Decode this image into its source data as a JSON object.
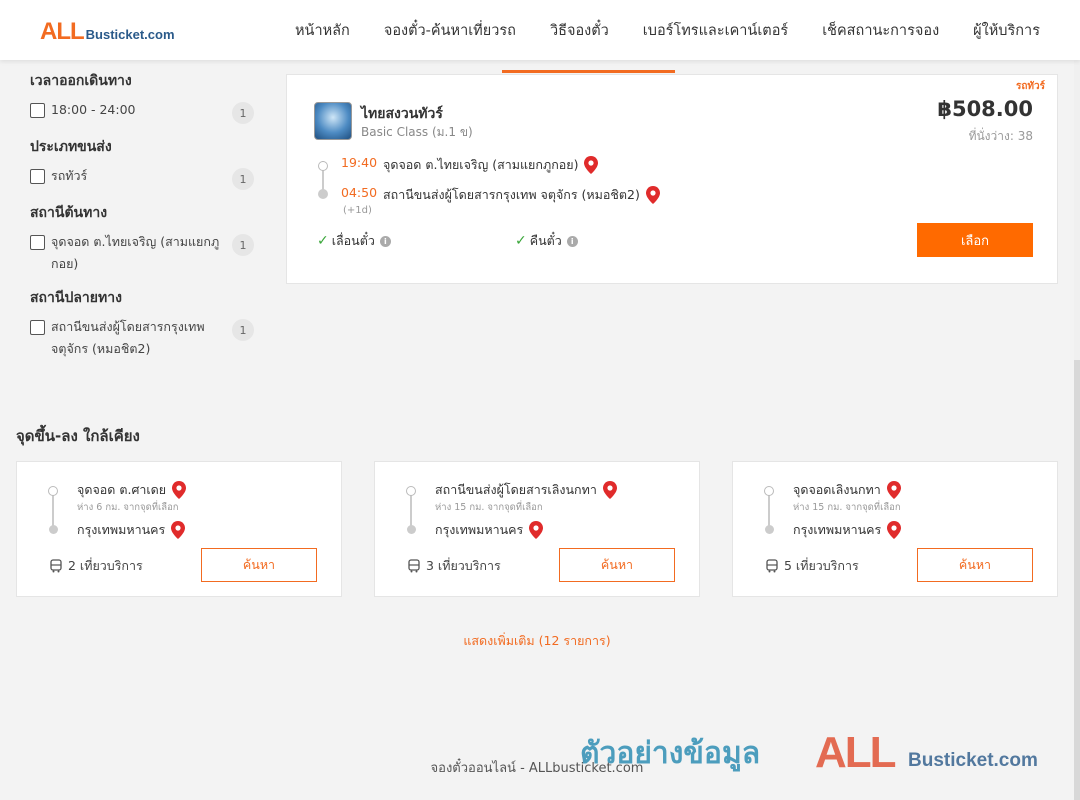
{
  "header": {
    "logo_all": "ALL",
    "logo_rest": "Busticket.com",
    "nav": [
      "หน้าหลัก",
      "จองตั๋ว-ค้นหาเที่ยวรถ",
      "วิธีจองตั๋ว",
      "เบอร์โทรและเคาน์เตอร์",
      "เช็คสถานะการจอง",
      "ผู้ให้บริการ"
    ]
  },
  "filters": [
    {
      "title": "เวลาออกเดินทาง",
      "options": [
        {
          "label": "18:00 - 24:00",
          "count": "1"
        }
      ]
    },
    {
      "title": "ประเภทขนส่ง",
      "options": [
        {
          "label": "รถทัวร์",
          "count": "1"
        }
      ]
    },
    {
      "title": "สถานีต้นทาง",
      "options": [
        {
          "label": "จุดจอด ต.ไทยเจริญ (สามแยกภูกอย)",
          "count": "1"
        }
      ]
    },
    {
      "title": "สถานีปลายทาง",
      "options": [
        {
          "label": "สถานีขนส่งผู้โดยสารกรุงเทพ จตุจักร (หมอชิต2)",
          "count": "1"
        }
      ]
    }
  ],
  "trip": {
    "tag": "รถทัวร์",
    "operator": "ไทยสงวนทัวร์",
    "class": "Basic Class (ม.1 ข)",
    "price": "฿508.00",
    "seats": "ที่นั่งว่าง: 38",
    "depart_time": "19:40",
    "depart_stop": "จุดจอด ต.ไทยเจริญ (สามแยกภูกอย)",
    "arrive_time": "04:50",
    "arrive_stop": "สถานีขนส่งผู้โดยสารกรุงเทพ จตุจักร (หมอชิต2)",
    "next_day": "(+1d)",
    "feature1": "เลื่อนตั๋ว",
    "feature2": "คืนตั๋ว",
    "select_label": "เลือก"
  },
  "nearby": {
    "title": "จุดขึ้น-ลง ใกล้เคียง",
    "cards": [
      {
        "from": "จุดจอด ต.ศาเดย",
        "distance": "ห่าง 6 กม. จากจุดที่เลือก",
        "to": "กรุงเทพมหานคร",
        "trips": "2 เที่ยวบริการ",
        "button": "ค้นหา"
      },
      {
        "from": "สถานีขนส่งผู้โดยสารเลิงนกทา",
        "distance": "ห่าง 15 กม. จากจุดที่เลือก",
        "to": "กรุงเทพมหานคร",
        "trips": "3 เที่ยวบริการ",
        "button": "ค้นหา"
      },
      {
        "from": "จุดจอดเลิงนกทา",
        "distance": "ห่าง 15 กม. จากจุดที่เลือก",
        "to": "กรุงเทพมหานคร",
        "trips": "5 เที่ยวบริการ",
        "button": "ค้นหา"
      }
    ],
    "more": "แสดงเพิ่มเติม (12 รายการ)"
  },
  "footer": {
    "text": "จองตั๋วออนไลน์ - ALLbusticket.com",
    "watermark_text": "ตัวอย่างข้อมูล",
    "watermark_all": "ALL",
    "watermark_rest": "Busticket.com"
  },
  "colors": {
    "accent": "#f26b21",
    "button": "#ff6a00",
    "check": "#3aa63a",
    "pin": "#e02b2b"
  }
}
